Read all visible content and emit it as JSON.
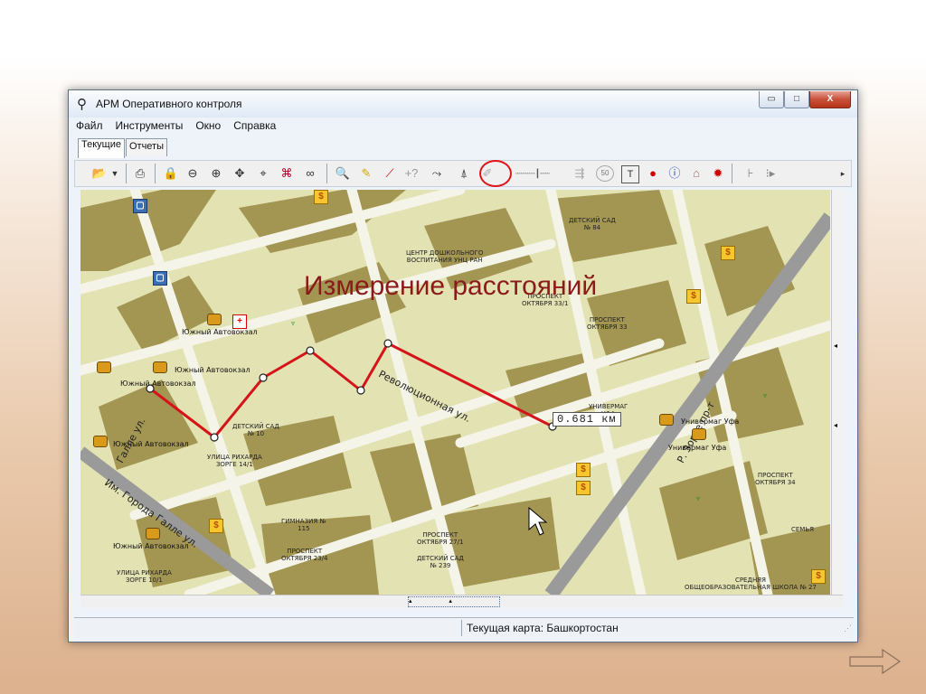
{
  "window": {
    "title": "АРМ Оперативного контроля",
    "controls": {
      "minimize": "▭",
      "maximize": "□",
      "close": "X"
    }
  },
  "menu": [
    "Файл",
    "Инструменты",
    "Окно",
    "Справка"
  ],
  "tabs": [
    {
      "label": "Текущие",
      "active": true
    },
    {
      "label": "Отчеты",
      "active": false
    }
  ],
  "toolbar": {
    "zoom_badge": "50",
    "text_tool": "T"
  },
  "overlay": {
    "title": "Измерение расстояний",
    "highlight_color": "#e0141a"
  },
  "map": {
    "measurement": {
      "distance_label": "0.681 км",
      "route_color": "#d4141a"
    },
    "street_labels": [
      "Революционная ул.",
      "Им. Города Галле ул.",
      "Р. Зорге пр-т",
      "Галле ул."
    ],
    "place_labels": [
      {
        "text": "ДЕТСКИЙ САД\n№ 84"
      },
      {
        "text": "ЦЕНТР ДОШКОЛЬНОГО\nВОСПИТАНИЯ УНЦ РАН"
      },
      {
        "text": "ПРОСПЕКТ\nОКТЯБРЯ 33/1"
      },
      {
        "text": "ПРОСПЕКТ\nОКТЯБРЯ 33"
      },
      {
        "text": "ДЕТСКИЙ САД\n№ 10"
      },
      {
        "text": "УЛИЦА РИХАРДА\nЗОРГЕ 14/1"
      },
      {
        "text": "УНИВЕРМАГ\nУФА"
      },
      {
        "text": "ПРОСПЕКТ\nОКТЯБРЯ 34"
      },
      {
        "text": "ГИМНАЗИЯ №\n115"
      },
      {
        "text": "ПРОСПЕКТ\nОКТЯБРЯ 27/1"
      },
      {
        "text": "ДЕТСКИЙ САД\n№ 239"
      },
      {
        "text": "ПРОСПЕКТ\nОКТЯБРЯ 23/4"
      },
      {
        "text": "УЛИЦА РИХАРДА\nЗОРГЕ 10/1"
      },
      {
        "text": "СЕМЬЯ"
      },
      {
        "text": "СРЕДНЯЯ\nОБЩЕОБРАЗОВАТЕЛЬНАЯ ШКОЛА № 27"
      }
    ],
    "stops": [
      {
        "text": "Южный Автовокзал"
      },
      {
        "text": "Южный Автовокзал"
      },
      {
        "text": "Южный Автовокзал"
      },
      {
        "text": "Южный Автовокзал"
      },
      {
        "text": "Южный Автовокзал"
      },
      {
        "text": "Универмаг Уфа"
      },
      {
        "text": "Универмаг Уфа"
      }
    ]
  },
  "status": {
    "current_map": "Текущая карта: Башкортостан"
  },
  "nav": {
    "next_icon": "right-arrow"
  }
}
